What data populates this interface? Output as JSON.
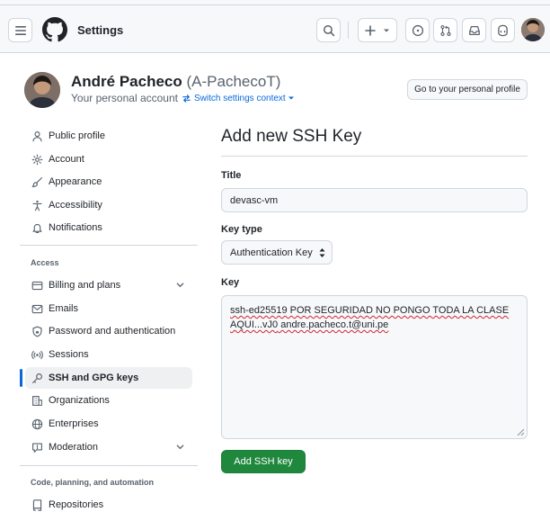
{
  "header": {
    "title": "Settings",
    "icons": [
      "menu-icon",
      "github-logo",
      "search-icon",
      "plus-icon",
      "caret-down-icon",
      "issues-icon",
      "pull-requests-icon",
      "inbox-icon",
      "copilot-icon"
    ]
  },
  "profile": {
    "name": "André Pacheco",
    "login": "(A-PachecoT)",
    "subtitle": "Your personal account",
    "switch_label": "Switch settings context",
    "goto_button": "Go to your personal profile"
  },
  "sidebar": {
    "items": [
      {
        "label": "Public profile",
        "icon": "person-icon"
      },
      {
        "label": "Account",
        "icon": "gear-icon"
      },
      {
        "label": "Appearance",
        "icon": "paintbrush-icon"
      },
      {
        "label": "Accessibility",
        "icon": "accessibility-icon"
      },
      {
        "label": "Notifications",
        "icon": "bell-icon"
      }
    ],
    "access_heading": "Access",
    "access_items": [
      {
        "label": "Billing and plans",
        "icon": "credit-card-icon"
      },
      {
        "label": "Emails",
        "icon": "mail-icon"
      },
      {
        "label": "Password and authentication",
        "icon": "shield-lock-icon"
      },
      {
        "label": "Sessions",
        "icon": "broadcast-icon"
      },
      {
        "label": "SSH and GPG keys",
        "icon": "key-icon",
        "active": true
      },
      {
        "label": "Organizations",
        "icon": "organization-icon"
      },
      {
        "label": "Enterprises",
        "icon": "globe-icon"
      },
      {
        "label": "Moderation",
        "icon": "report-icon"
      }
    ],
    "code_heading": "Code, planning, and automation",
    "code_items": [
      {
        "label": "Repositories",
        "icon": "repo-icon"
      }
    ]
  },
  "form": {
    "heading": "Add new SSH Key",
    "title_label": "Title",
    "title_value": "devasc-vm",
    "key_type_label": "Key type",
    "key_type_value": "Authentication Key",
    "key_label": "Key",
    "key_line1": "ssh-ed25519 POR SEGURIDAD NO PONGO TODA LA CLASE",
    "key_line2_a": "AQUI...vJ0",
    "key_line2_b": " andre.pacheco.t@uni.pe",
    "submit_label": "Add SSH key"
  },
  "colors": {
    "accent": "#0969da",
    "primary_button": "#1f883d",
    "border": "#d0d7de",
    "header_bg": "#f6f8fa"
  }
}
